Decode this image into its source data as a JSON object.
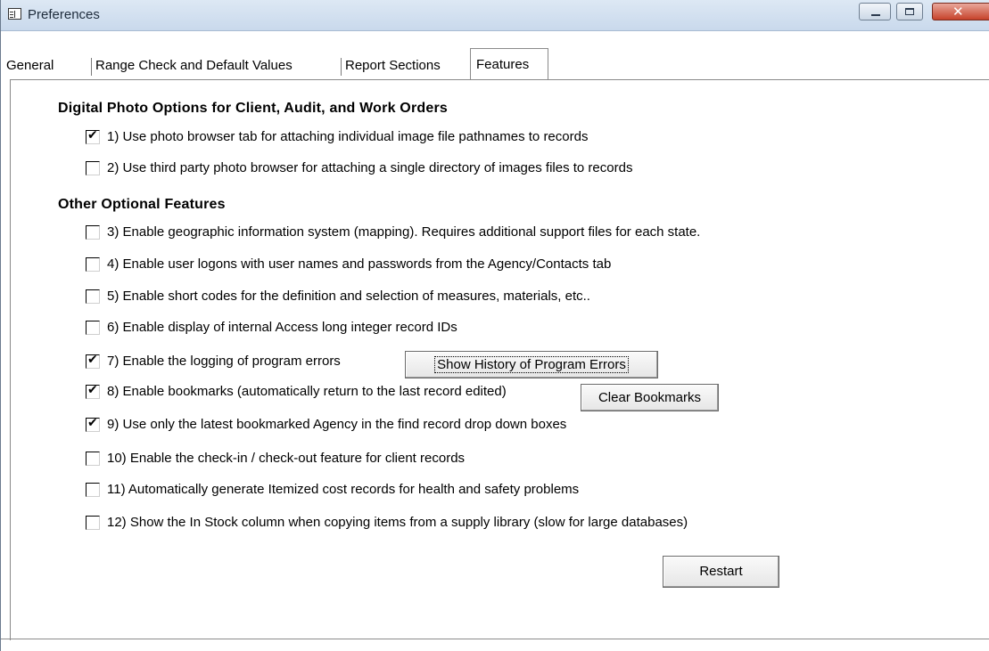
{
  "window": {
    "title": "Preferences",
    "icon": "form-icon"
  },
  "tabs": [
    {
      "label": "General",
      "active": false
    },
    {
      "label": "Range Check and Default Values",
      "active": false
    },
    {
      "label": "Report Sections",
      "active": false
    },
    {
      "label": "Features",
      "active": true
    }
  ],
  "sections": {
    "photo": {
      "heading": "Digital Photo Options for Client, Audit, and Work Orders",
      "options": [
        {
          "label": "1) Use photo browser tab for attaching individual image file pathnames to records",
          "checked": true
        },
        {
          "label": "2) Use third party photo browser for attaching a single directory of images files to records",
          "checked": false
        }
      ]
    },
    "other": {
      "heading": "Other Optional Features",
      "options": [
        {
          "label": "3) Enable geographic information system (mapping).  Requires additional support files for each state.",
          "checked": false
        },
        {
          "label": "4) Enable user logons with user names and passwords from the Agency/Contacts tab",
          "checked": false
        },
        {
          "label": "5) Enable short codes for the definition and selection of measures, materials, etc..",
          "checked": false
        },
        {
          "label": "6) Enable display of internal Access long integer record IDs",
          "checked": false
        },
        {
          "label": "7) Enable the logging of program errors",
          "checked": true
        },
        {
          "label": "8) Enable bookmarks (automatically return to the last record edited)",
          "checked": true
        },
        {
          "label": "9) Use only the latest bookmarked Agency in the find record drop down boxes",
          "checked": true
        },
        {
          "label": "10) Enable the check-in / check-out feature for client records",
          "checked": false
        },
        {
          "label": "11) Automatically generate Itemized cost records for health and safety problems",
          "checked": false
        },
        {
          "label": "12) Show the In Stock column when copying items from a supply library (slow for large databases)",
          "checked": false
        }
      ]
    }
  },
  "buttons": {
    "show_history": "Show History of Program Errors",
    "clear_bookmarks": "Clear Bookmarks",
    "restart": "Restart"
  }
}
